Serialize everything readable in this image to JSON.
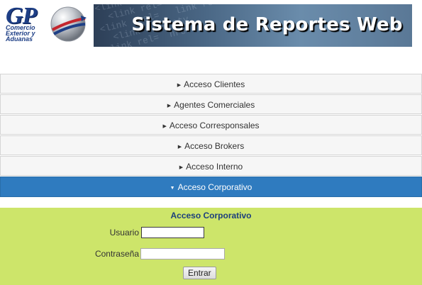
{
  "header": {
    "logo_letters": "GP",
    "logo_subtitle": "Comercio Exterior y Aduanas",
    "banner_title": "Sistema de Reportes Web",
    "banner_code_text": "<link rel= stylesheet\n  <link rel=  href=\n<link  rel=   link re\n  <link rel= sty\n<link rel=  href"
  },
  "menu": {
    "items": [
      {
        "label": "Acceso Clientes",
        "active": false
      },
      {
        "label": "Agentes Comerciales",
        "active": false
      },
      {
        "label": "Acceso Corresponsales",
        "active": false
      },
      {
        "label": "Acceso Brokers",
        "active": false
      },
      {
        "label": "Acceso Interno",
        "active": false
      },
      {
        "label": "Acceso Corporativo",
        "active": true
      }
    ]
  },
  "login": {
    "title": "Acceso Corporativo",
    "user_label": "Usuario",
    "user_value": "",
    "password_label": "Contraseña",
    "password_value": "",
    "submit_label": "Entrar"
  },
  "colors": {
    "active_tab": "#2f7bbf",
    "panel_bg": "#cde56a",
    "panel_title": "#1c3f7d",
    "logo_blue": "#1e3f86"
  }
}
